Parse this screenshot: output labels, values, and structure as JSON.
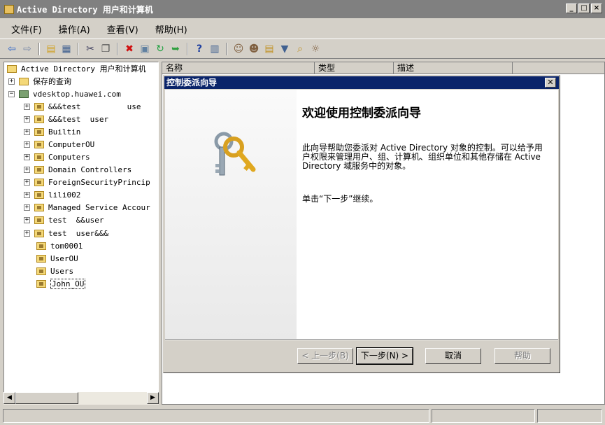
{
  "window": {
    "title": "Active Directory 用户和计算机",
    "controls": [
      "_",
      "□",
      "×"
    ]
  },
  "menu": [
    "文件(F)",
    "操作(A)",
    "查看(V)",
    "帮助(H)"
  ],
  "tree": {
    "root": "Active Directory 用户和计算机",
    "saved_queries": "保存的查询",
    "domain": "vdesktop.huawei.com",
    "items": [
      {
        "label": "&&&test          use",
        "expandable": true
      },
      {
        "label": "&&&test  user",
        "expandable": true
      },
      {
        "label": "Builtin",
        "expandable": true
      },
      {
        "label": "ComputerOU",
        "expandable": true
      },
      {
        "label": "Computers",
        "expandable": true
      },
      {
        "label": "Domain Controllers",
        "expandable": true
      },
      {
        "label": "ForeignSecurityPrincip",
        "expandable": true
      },
      {
        "label": "lili002",
        "expandable": true
      },
      {
        "label": "Managed Service Accour",
        "expandable": true
      },
      {
        "label": "test  &&user",
        "expandable": true
      },
      {
        "label": "test  user&&&",
        "expandable": true
      },
      {
        "label": "tom0001",
        "expandable": false
      },
      {
        "label": "UserOU",
        "expandable": false
      },
      {
        "label": "Users",
        "expandable": false
      },
      {
        "label": "John_OU",
        "expandable": false,
        "selected": true
      }
    ]
  },
  "list": {
    "columns": [
      "名称",
      "类型",
      "描述"
    ]
  },
  "dialog": {
    "title": "控制委派向导",
    "welcome": "欢迎使用控制委派向导",
    "description": "此向导帮助您委派对 Active Directory 对象的控制。可以给予用户权限来管理用户、组、计算机、组织单位和其他存储在 Active Directory 域服务中的对象。",
    "hint": "单击“下一步”继续。",
    "buttons": {
      "back": "< 上一步(B)",
      "next": "下一步(N) >",
      "cancel": "取消",
      "help": "帮助"
    }
  },
  "colors": {
    "title_active": "#0a246a",
    "title_inactive": "#808080",
    "face": "#d4d0c8"
  },
  "icons": [
    "back-arrow-icon",
    "forward-arrow-icon",
    "up-folder-icon",
    "console-tree-icon",
    "cut-icon",
    "copy-icon",
    "delete-icon",
    "properties-icon",
    "refresh-icon",
    "export-icon",
    "help-icon",
    "mmc-icon",
    "new-user-icon",
    "new-group-icon",
    "new-ou-icon",
    "filter-icon",
    "find-icon",
    "delegate-icon"
  ]
}
